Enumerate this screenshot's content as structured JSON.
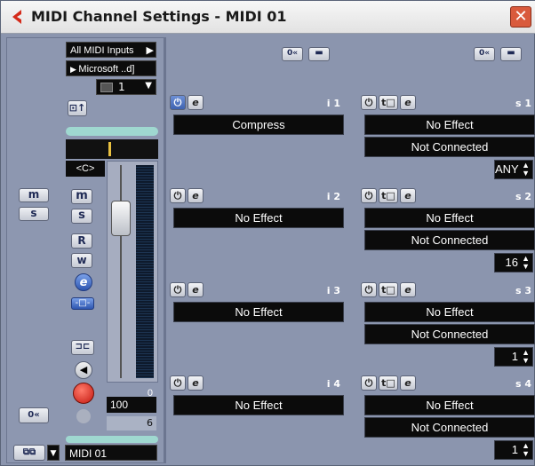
{
  "window": {
    "title": "MIDI Channel Settings - MIDI 01"
  },
  "left": {
    "input_routing": "All MIDI Inputs",
    "output_routing": "Microsoft ..d]",
    "channel": "1",
    "pan": "<C>",
    "buttons": {
      "mute": "m",
      "solo": "s",
      "read": "R",
      "write": "w",
      "edit": "e"
    },
    "meter_peak": "0",
    "volume": "100",
    "program": "6",
    "track_name": "MIDI 01",
    "ms_labels": {
      "m": "m",
      "s": "s"
    }
  },
  "inserts": [
    {
      "label": "i 1",
      "effect": "Compress",
      "active": true
    },
    {
      "label": "i 2",
      "effect": "No Effect",
      "active": false
    },
    {
      "label": "i 3",
      "effect": "No Effect",
      "active": false
    },
    {
      "label": "i 4",
      "effect": "No Effect",
      "active": false
    }
  ],
  "sends": [
    {
      "label": "s 1",
      "effect": "No Effect",
      "connection": "Not Connected",
      "value": "ANY"
    },
    {
      "label": "s 2",
      "effect": "No Effect",
      "connection": "Not Connected",
      "value": "16"
    },
    {
      "label": "s 3",
      "effect": "No Effect",
      "connection": "Not Connected",
      "value": "1"
    },
    {
      "label": "s 4",
      "effect": "No Effect",
      "connection": "Not Connected",
      "value": "1"
    }
  ]
}
